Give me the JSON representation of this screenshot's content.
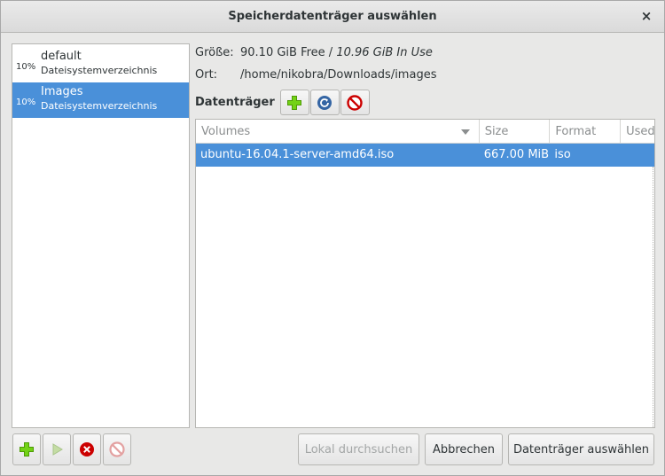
{
  "window": {
    "title": "Speicherdatenträger auswählen",
    "close_glyph": "×"
  },
  "pools": [
    {
      "percent": "10%",
      "name": "default",
      "desc": "Dateisystemverzeichnis",
      "selected": false
    },
    {
      "percent": "10%",
      "name": "Images",
      "desc": "Dateisystemverzeichnis",
      "selected": true
    }
  ],
  "info": {
    "size_label": "Größe:",
    "free": "90.10 GiB Free",
    "sep": " / ",
    "in_use": "10.96 GiB In Use",
    "location_label": "Ort:",
    "location": "/home/nikobra/Downloads/images"
  },
  "volumes": {
    "label": "Datenträger",
    "columns": [
      "Volumes",
      "Size",
      "Format",
      "Used"
    ],
    "rows": [
      {
        "name": "ubuntu-16.04.1-server-amd64.iso",
        "size": "667.00 MiB",
        "format": "iso",
        "used": ""
      }
    ]
  },
  "buttons": {
    "browse_local": "Lokal durchsuchen",
    "cancel": "Abbrechen",
    "choose_volume": "Datenträger auswählen"
  },
  "colors": {
    "selection": "#4a90d9",
    "add_green": "#73d216",
    "refresh_blue": "#3465a4",
    "delete_red": "#cc0000"
  },
  "icons": {
    "add": "add-icon",
    "refresh": "refresh-icon",
    "delete": "delete-icon",
    "start": "play-icon",
    "stop": "stop-icon"
  }
}
